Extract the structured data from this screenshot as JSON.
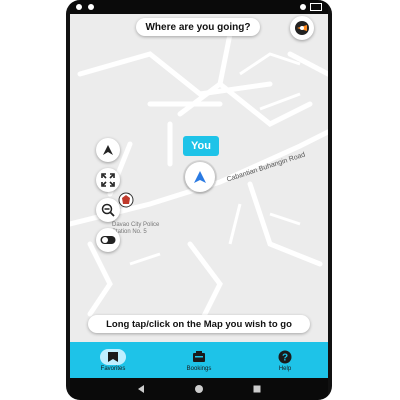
{
  "search": {
    "prompt": "Where are you going?"
  },
  "you_label": "You",
  "map": {
    "road_name": "Cabantian Buhangin Road",
    "place_name": "Davao City Police Station No. 5"
  },
  "hint": "Long tap/click on the Map you wish to go",
  "bottom_nav": {
    "favorites": "Favorites",
    "bookings": "Bookings",
    "help": "Help"
  },
  "colors": {
    "accent": "#1ec3e8",
    "map_bg": "#ececec"
  },
  "icons": [
    "menu-icon",
    "navigation-arrow-icon",
    "fullscreen-icon",
    "zoom-out-icon",
    "toggle-icon",
    "favorite-icon",
    "bookings-icon",
    "help-icon",
    "back-icon",
    "home-icon",
    "recents-icon"
  ]
}
